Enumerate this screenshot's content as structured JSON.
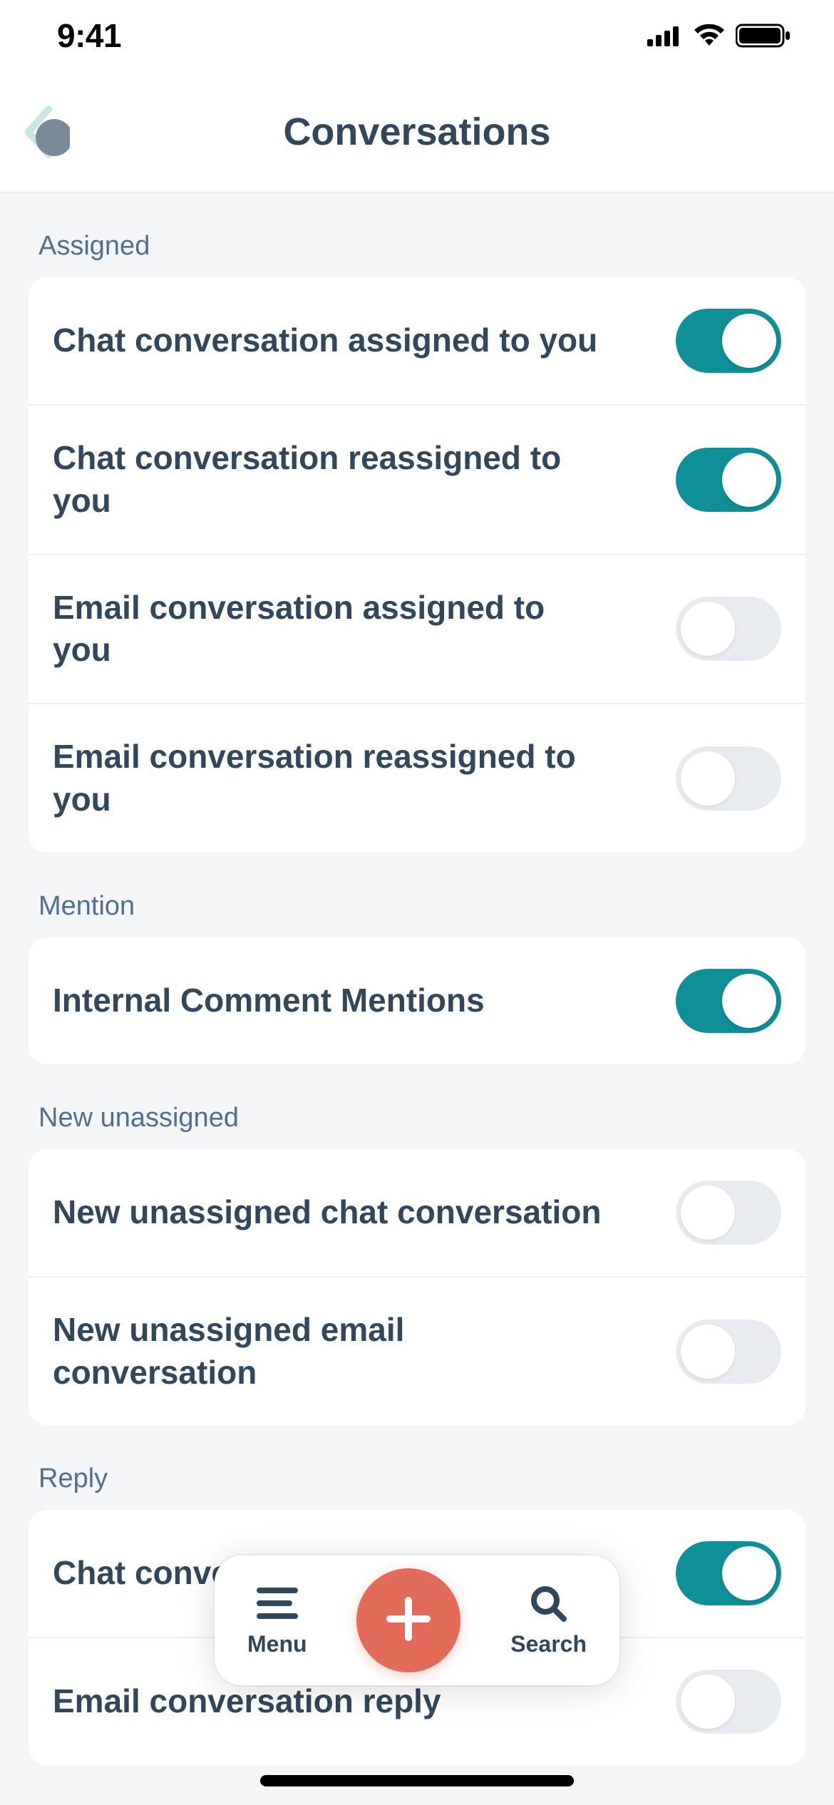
{
  "status": {
    "time": "9:41"
  },
  "header": {
    "title": "Conversations"
  },
  "sections": {
    "assigned": {
      "label": "Assigned",
      "items": [
        {
          "label": "Chat conversation assigned to you",
          "on": true
        },
        {
          "label": "Chat conversation reassigned to you",
          "on": true
        },
        {
          "label": "Email conversation assigned to you",
          "on": false
        },
        {
          "label": "Email conversation reassigned to you",
          "on": false
        }
      ]
    },
    "mention": {
      "label": "Mention",
      "items": [
        {
          "label": "Internal Comment Mentions",
          "on": true
        }
      ]
    },
    "new_unassigned": {
      "label": "New unassigned",
      "items": [
        {
          "label": "New unassigned chat conversation",
          "on": false
        },
        {
          "label": "New unassigned email conversation",
          "on": false
        }
      ]
    },
    "reply": {
      "label": "Reply",
      "items": [
        {
          "label": "Chat conversation reply",
          "on": true
        },
        {
          "label": "Email conversation reply",
          "on": false
        }
      ]
    }
  },
  "floating": {
    "menu": "Menu",
    "search": "Search"
  },
  "colors": {
    "toggle_on": "#0f9098",
    "toggle_off": "#e7ebef",
    "accent_add": "#e36b59",
    "text_primary": "#33475b",
    "text_secondary": "#516f90"
  }
}
